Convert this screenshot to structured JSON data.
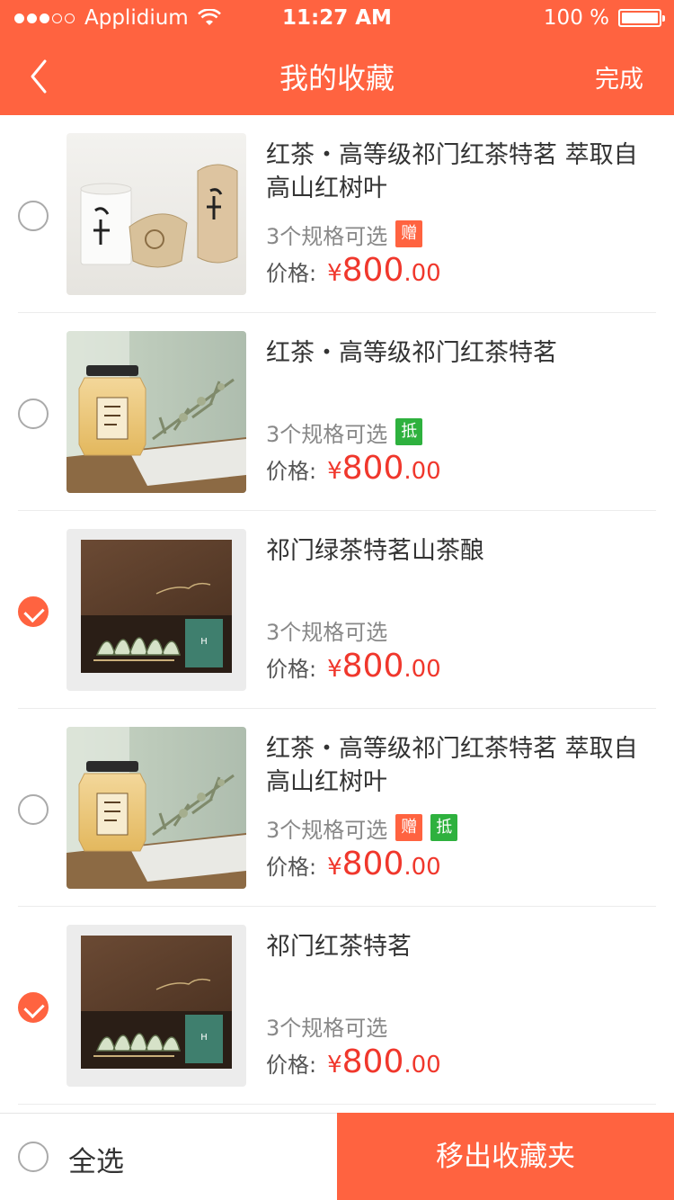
{
  "status_bar": {
    "carrier": "Applidium",
    "time": "11:27 AM",
    "battery": "100 %"
  },
  "nav": {
    "title": "我的收藏",
    "done_label": "完成",
    "back_icon": "chevron-left-icon"
  },
  "items": [
    {
      "title": "红茶・高等级祁门红茶特茗  萃取自高山红树叶",
      "specs": "3个规格可选",
      "badges": [
        "赠"
      ],
      "price_label": "价格:",
      "currency": "¥",
      "price_int": "800",
      "price_dec": ".00",
      "checked": false,
      "image": "tea-tins"
    },
    {
      "title": "红茶・高等级祁门红茶特茗",
      "specs": "3个规格可选",
      "badges": [
        "抵"
      ],
      "price_label": "价格:",
      "currency": "¥",
      "price_int": "800",
      "price_dec": ".00",
      "checked": false,
      "image": "honey-jar"
    },
    {
      "title": "祁门绿茶特茗山茶酿",
      "specs": "3个规格可选",
      "badges": [],
      "price_label": "价格:",
      "currency": "¥",
      "price_int": "800",
      "price_dec": ".00",
      "checked": true,
      "image": "wood-box"
    },
    {
      "title": "红茶・高等级祁门红茶特茗  萃取自高山红树叶",
      "specs": "3个规格可选",
      "badges": [
        "赠",
        "抵"
      ],
      "price_label": "价格:",
      "currency": "¥",
      "price_int": "800",
      "price_dec": ".00",
      "checked": false,
      "image": "honey-jar"
    },
    {
      "title": "祁门红茶特茗",
      "specs": "3个规格可选",
      "badges": [],
      "price_label": "价格:",
      "currency": "¥",
      "price_int": "800",
      "price_dec": ".00",
      "checked": true,
      "image": "wood-box"
    }
  ],
  "footer": {
    "select_all_label": "全选",
    "remove_label": "移出收藏夹"
  },
  "colors": {
    "accent": "#ff6340",
    "price": "#f0372c",
    "badge_gift": "#ff6340",
    "badge_deduct": "#2eb13e"
  }
}
